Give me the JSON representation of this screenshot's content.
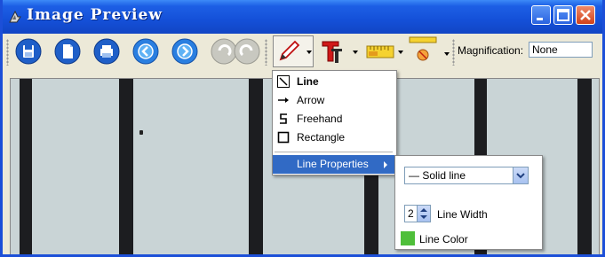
{
  "window": {
    "title": "Image Preview",
    "controls": [
      "minimize",
      "maximize",
      "close"
    ]
  },
  "toolbar": {
    "icons": [
      "save-icon",
      "copy-icon",
      "print-icon",
      "previous-icon",
      "next-icon",
      "undo-icon",
      "redo-icon",
      "pencil-icon",
      "text-icon",
      "ruler-icon",
      "measure-icon"
    ],
    "magnification_label": "Magnification:",
    "magnification_value": "None"
  },
  "draw_menu": {
    "items": [
      {
        "label": "Line",
        "icon": "line-icon"
      },
      {
        "label": "Arrow",
        "icon": "arrow-icon"
      },
      {
        "label": "Freehand",
        "icon": "freehand-icon"
      },
      {
        "label": "Rectangle",
        "icon": "rectangle-icon"
      }
    ],
    "properties_label": "Line Properties"
  },
  "line_properties": {
    "style_value": "— Solid line",
    "width_value": "2",
    "width_label": "Line Width",
    "color_label": "Line Color",
    "color": "#4fbf3a"
  }
}
